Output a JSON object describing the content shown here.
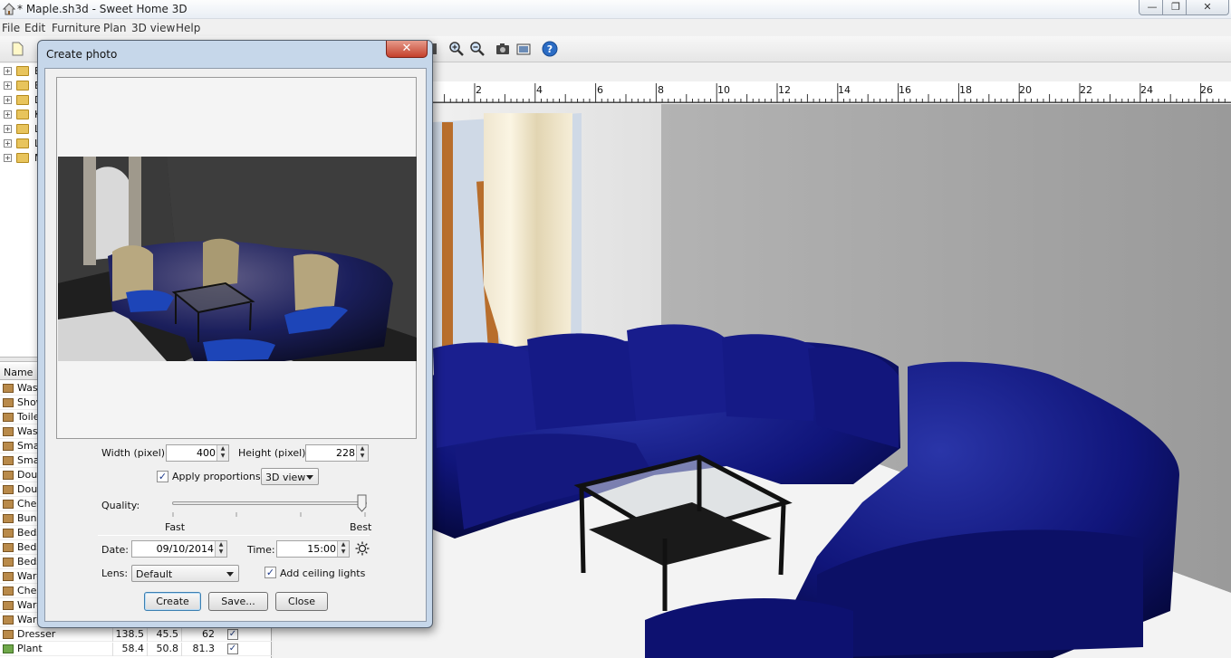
{
  "window": {
    "title": "* Maple.sh3d - Sweet Home 3D",
    "minimize_symbol": "—",
    "maximize_symbol": "❐",
    "close_symbol": "✕"
  },
  "menu": [
    "File",
    "Edit",
    "Furniture",
    "Plan",
    "3D view",
    "Help"
  ],
  "toolbar_icons": [
    "new-icon",
    "save-icon",
    "zoom-in-icon",
    "zoom-out-icon",
    "create-photo-icon",
    "create-video-icon",
    "help-icon"
  ],
  "catalog": {
    "categories": [
      "B",
      "B",
      "D",
      "K",
      "L",
      "L",
      "M"
    ],
    "expander_symbol": "+"
  },
  "furniture_list": {
    "header": "Name",
    "rows": [
      {
        "name": "Was"
      },
      {
        "name": "Show"
      },
      {
        "name": "Toile"
      },
      {
        "name": "Wash"
      },
      {
        "name": "Smal"
      },
      {
        "name": "Smal"
      },
      {
        "name": "Doub"
      },
      {
        "name": "Doub"
      },
      {
        "name": "Ches"
      },
      {
        "name": "Bunk"
      },
      {
        "name": "Beds"
      },
      {
        "name": "Beds"
      },
      {
        "name": "Beds"
      },
      {
        "name": "Ward"
      },
      {
        "name": "Ches"
      },
      {
        "name": "Ward"
      },
      {
        "name": "Ward"
      },
      {
        "name": "Dresser",
        "w": "138.5",
        "d": "45.5",
        "h": "62",
        "visible": "✓"
      },
      {
        "name": "Plant",
        "w": "58.4",
        "d": "50.8",
        "h": "81.3",
        "visible": "✓"
      }
    ]
  },
  "ruler": {
    "labels": [
      "2",
      "4",
      "6",
      "8",
      "10",
      "12",
      "14",
      "16",
      "18",
      "20",
      "22",
      "24",
      "26"
    ]
  },
  "dialog": {
    "title": "Create photo",
    "close_symbol": "✕",
    "width_label": "Width (pixel):",
    "width_value": "400",
    "height_label": "Height (pixel):",
    "height_value": "228",
    "apply_proportions_label": "Apply proportions:",
    "apply_proportions_checked": true,
    "check_mark": "✓",
    "proportions_value": "3D view",
    "quality_label": "Quality:",
    "quality_min_label": "Fast",
    "quality_max_label": "Best",
    "quality_level": 1.0,
    "date_label": "Date:",
    "date_value": "09/10/2014",
    "time_label": "Time:",
    "time_value": "15:00",
    "lens_label": "Lens:",
    "lens_value": "Default",
    "ceiling_lights_label": "Add ceiling lights",
    "ceiling_lights_checked": true,
    "create_button": "Create",
    "save_button": "Save...",
    "close_button": "Close"
  },
  "colors": {
    "sofa": "#0f1273",
    "cushion": "#1e3fae",
    "dialog_frame": "#c6d7ea"
  }
}
